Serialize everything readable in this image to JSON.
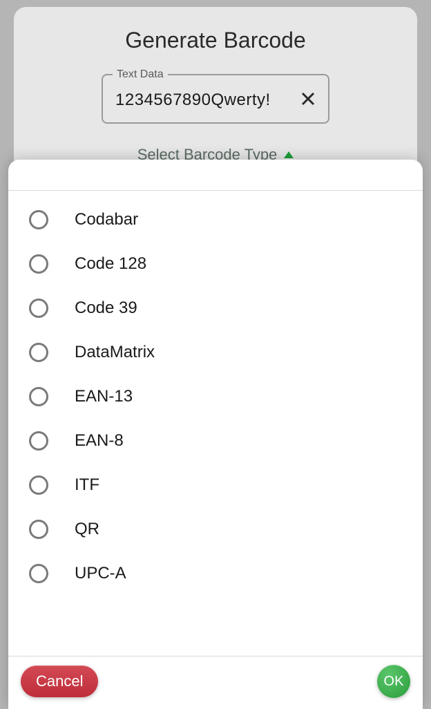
{
  "header": {
    "title": "Generate Barcode"
  },
  "textField": {
    "label": "Text Data",
    "value": "1234567890Qwerty!"
  },
  "selector": {
    "label": "Select Barcode Type"
  },
  "options": [
    {
      "label": "Codabar"
    },
    {
      "label": "Code 128"
    },
    {
      "label": "Code 39"
    },
    {
      "label": "DataMatrix"
    },
    {
      "label": "EAN-13"
    },
    {
      "label": "EAN-8"
    },
    {
      "label": "ITF"
    },
    {
      "label": "QR"
    },
    {
      "label": "UPC-A"
    }
  ],
  "footer": {
    "cancel": "Cancel",
    "ok": "OK"
  }
}
